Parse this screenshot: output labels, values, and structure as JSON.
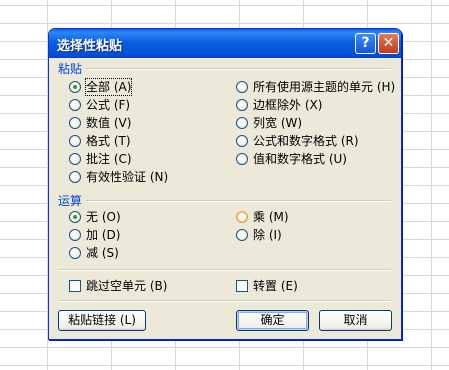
{
  "dialog": {
    "title": "选择性粘贴",
    "help_glyph": "?",
    "close_glyph": "✕"
  },
  "paste": {
    "label": "粘贴",
    "left": [
      {
        "label": "全部 (A)",
        "checked": true
      },
      {
        "label": "公式 (F)",
        "checked": false
      },
      {
        "label": "数值 (V)",
        "checked": false
      },
      {
        "label": "格式 (T)",
        "checked": false
      },
      {
        "label": "批注 (C)",
        "checked": false
      },
      {
        "label": "有效性验证 (N)",
        "checked": false
      }
    ],
    "right": [
      {
        "label": "所有使用源主题的单元 (H)",
        "checked": false
      },
      {
        "label": "边框除外 (X)",
        "checked": false
      },
      {
        "label": "列宽 (W)",
        "checked": false
      },
      {
        "label": "公式和数字格式 (R)",
        "checked": false
      },
      {
        "label": "值和数字格式 (U)",
        "checked": false
      }
    ]
  },
  "operation": {
    "label": "运算",
    "left": [
      {
        "label": "无 (O)",
        "checked": true
      },
      {
        "label": "加 (D)",
        "checked": false
      },
      {
        "label": "减 (S)",
        "checked": false
      }
    ],
    "right": [
      {
        "label": "乘 (M)",
        "checked": false
      },
      {
        "label": "除 (I)",
        "checked": false
      }
    ]
  },
  "checkboxes": {
    "skip_blanks": {
      "label": "跳过空单元 (B)",
      "checked": false
    },
    "transpose": {
      "label": "转置 (E)",
      "checked": false
    }
  },
  "buttons": {
    "paste_link": "粘贴链接 (L)",
    "ok": "确定",
    "cancel": "取消"
  }
}
